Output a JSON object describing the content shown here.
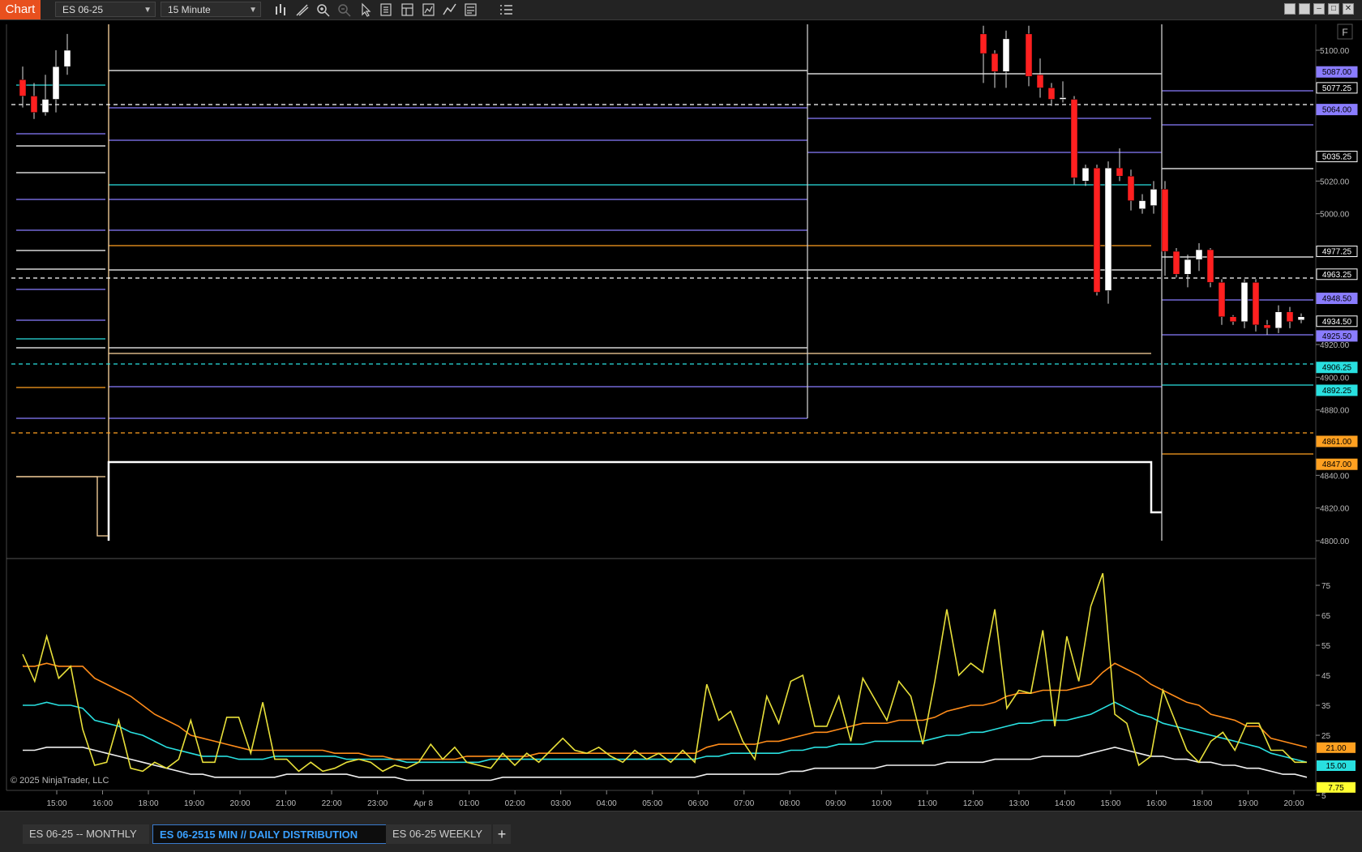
{
  "toolbar": {
    "chart_label": "Chart",
    "instrument": "ES 06-25",
    "interval": "15 Minute",
    "icons": [
      "bar-style-icon",
      "draw-tools-icon",
      "zoom-in-icon",
      "zoom-out-icon",
      "pointer-icon",
      "data-box-icon",
      "templates-icon",
      "strategies-icon",
      "indicators-icon",
      "chart-properties-icon",
      "more-options-icon"
    ]
  },
  "window_controls": [
    "restore",
    "tile",
    "minimize",
    "maximize",
    "close"
  ],
  "chart": {
    "f_button": "F",
    "copyright": "© 2025 NinjaTrader, LLC",
    "price_ticks": [
      "5100.00",
      "5020.00",
      "5000.00",
      "4920.00",
      "4900.00",
      "4880.00",
      "4840.00",
      "4820.00",
      "4800.00"
    ],
    "price_labels": [
      {
        "text": "5087.00",
        "bg": "#8a7cff",
        "fg": "#000"
      },
      {
        "text": "5077.25",
        "bg": "#000",
        "fg": "#fff",
        "border": "#ffffff"
      },
      {
        "text": "5064.00",
        "bg": "#8a7cff",
        "fg": "#000"
      },
      {
        "text": "5035.25",
        "bg": "#000",
        "fg": "#fff",
        "border": "#ffffff"
      },
      {
        "text": "4977.25",
        "bg": "#000",
        "fg": "#fff",
        "border": "#ffffff"
      },
      {
        "text": "4963.25",
        "bg": "#000",
        "fg": "#fff",
        "border": "#ffffff"
      },
      {
        "text": "4948.50",
        "bg": "#8a7cff",
        "fg": "#000"
      },
      {
        "text": "4934.50",
        "bg": "#000",
        "fg": "#fff",
        "border": "#ffffff"
      },
      {
        "text": "4925.50",
        "bg": "#8a7cff",
        "fg": "#000"
      },
      {
        "text": "4906.25",
        "bg": "#29e0e0",
        "fg": "#000"
      },
      {
        "text": "4892.25",
        "bg": "#29e0e0",
        "fg": "#000"
      },
      {
        "text": "4861.00",
        "bg": "#ffa020",
        "fg": "#000"
      },
      {
        "text": "4847.00",
        "bg": "#ffa020",
        "fg": "#000"
      }
    ],
    "osc_ticks": [
      "75",
      "65",
      "55",
      "45",
      "35",
      "25",
      "5"
    ],
    "osc_labels": [
      {
        "text": "21.00",
        "bg": "#ffa020"
      },
      {
        "text": "15.00",
        "bg": "#29e0e0"
      },
      {
        "text": "7.75",
        "bg": "#ffff30"
      }
    ],
    "time_labels": [
      "15:00",
      "16:00",
      "18:00",
      "19:00",
      "20:00",
      "21:00",
      "22:00",
      "23:00",
      "Apr 8",
      "01:00",
      "02:00",
      "03:00",
      "04:00",
      "05:00",
      "06:00",
      "07:00",
      "08:00",
      "09:00",
      "10:00",
      "11:00",
      "12:00",
      "13:00",
      "14:00",
      "15:00",
      "16:00",
      "18:00",
      "19:00",
      "20:00"
    ]
  },
  "chart_data": {
    "type": "line",
    "ylim_price": [
      4790,
      5110
    ],
    "ylim_osc": [
      0,
      80
    ],
    "oscillator_series": [
      {
        "color": "#e8e03a",
        "values": [
          52,
          43,
          58,
          44,
          48,
          27,
          15,
          16,
          30,
          14,
          13,
          16,
          14,
          17,
          30,
          16,
          16,
          31,
          31,
          19,
          36,
          17,
          17,
          13,
          16,
          13,
          14,
          16,
          17,
          16,
          13,
          15,
          14,
          16,
          22,
          17,
          21,
          16,
          15,
          14,
          19,
          15,
          19,
          16,
          20,
          24,
          20,
          19,
          21,
          18,
          16,
          20,
          17,
          19,
          16,
          20,
          16,
          42,
          30,
          33,
          23,
          17,
          38,
          29,
          43,
          45,
          28,
          28,
          38,
          23,
          44,
          37,
          30,
          43,
          38,
          22,
          43,
          67,
          45,
          49,
          46,
          67,
          34,
          40,
          39,
          60,
          28,
          58,
          43,
          68,
          79,
          32,
          29,
          15,
          18,
          40,
          30,
          20,
          16,
          23,
          26,
          20,
          29,
          29,
          20,
          20,
          16,
          16
        ]
      },
      {
        "color": "#ff8c1a",
        "values": [
          48,
          48,
          49,
          48,
          48,
          48,
          44,
          42,
          40,
          38,
          35,
          32,
          30,
          28,
          25,
          24,
          23,
          22,
          21,
          20,
          20,
          20,
          20,
          20,
          20,
          20,
          19,
          19,
          19,
          18,
          18,
          17,
          17,
          17,
          17,
          17,
          17,
          18,
          18,
          18,
          18,
          18,
          18,
          19,
          19,
          19,
          19,
          19,
          19,
          19,
          19,
          19,
          19,
          19,
          19,
          19,
          19,
          21,
          22,
          22,
          22,
          22,
          23,
          23,
          24,
          25,
          26,
          26,
          27,
          28,
          29,
          29,
          29,
          30,
          30,
          30,
          31,
          33,
          34,
          35,
          35,
          36,
          38,
          39,
          39,
          40,
          40,
          40,
          41,
          42,
          46,
          49,
          47,
          45,
          42,
          40,
          38,
          36,
          35,
          32,
          31,
          30,
          28,
          28,
          24,
          23,
          22,
          21
        ]
      },
      {
        "color": "#29e0e0",
        "values": [
          35,
          35,
          36,
          35,
          35,
          34,
          30,
          29,
          28,
          26,
          25,
          23,
          21,
          20,
          19,
          18,
          18,
          18,
          17,
          17,
          17,
          18,
          18,
          18,
          18,
          18,
          18,
          17,
          17,
          17,
          17,
          17,
          16,
          16,
          16,
          16,
          16,
          16,
          16,
          17,
          17,
          17,
          17,
          17,
          17,
          17,
          17,
          17,
          17,
          17,
          17,
          17,
          17,
          17,
          17,
          17,
          17,
          18,
          18,
          19,
          19,
          19,
          19,
          19,
          20,
          20,
          21,
          21,
          22,
          22,
          22,
          23,
          23,
          23,
          23,
          23,
          24,
          25,
          25,
          26,
          26,
          27,
          28,
          29,
          29,
          30,
          30,
          30,
          31,
          32,
          34,
          36,
          34,
          32,
          31,
          29,
          28,
          27,
          26,
          25,
          24,
          23,
          22,
          21,
          19,
          18,
          17,
          16
        ]
      },
      {
        "color": "#f0f0f0",
        "values": [
          20,
          20,
          21,
          21,
          21,
          21,
          20,
          19,
          18,
          17,
          16,
          15,
          14,
          13,
          12,
          12,
          11,
          11,
          11,
          11,
          11,
          11,
          12,
          12,
          12,
          12,
          12,
          12,
          11,
          11,
          11,
          11,
          10,
          10,
          10,
          10,
          10,
          10,
          10,
          10,
          11,
          11,
          11,
          11,
          11,
          11,
          11,
          11,
          11,
          11,
          11,
          11,
          11,
          11,
          11,
          11,
          11,
          12,
          12,
          12,
          12,
          12,
          12,
          12,
          13,
          13,
          14,
          14,
          14,
          14,
          14,
          14,
          15,
          15,
          15,
          15,
          15,
          16,
          16,
          16,
          16,
          17,
          17,
          17,
          17,
          18,
          18,
          18,
          18,
          19,
          20,
          21,
          20,
          19,
          18,
          18,
          17,
          17,
          16,
          16,
          15,
          15,
          14,
          14,
          13,
          12,
          12,
          11
        ]
      }
    ]
  },
  "tabs": [
    {
      "label": "ES 06-25 -- MONTHLY",
      "active": false
    },
    {
      "label": "ES 06-2515 MIN // DAILY DISTRIBUTION",
      "active": true
    },
    {
      "label": "ES 06-25 WEEKLY",
      "active": false
    }
  ],
  "add_tab": "+"
}
